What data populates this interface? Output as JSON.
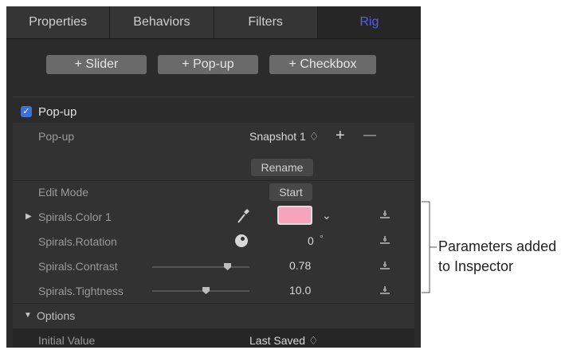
{
  "tabs": [
    "Properties",
    "Behaviors",
    "Filters",
    "Rig"
  ],
  "add_buttons": {
    "slider": "+ Slider",
    "popup": "+ Pop-up",
    "checkbox": "+ Checkbox"
  },
  "group": {
    "title": "Pop-up",
    "checked": true
  },
  "popup_row": {
    "label": "Pop-up",
    "value": "Snapshot 1 ♢",
    "add": "+",
    "remove": "—"
  },
  "rename_label": "Rename",
  "edit_mode": {
    "label": "Edit Mode",
    "button": "Start"
  },
  "params": {
    "color": {
      "label": "Spirals.Color 1",
      "swatch": "#f6a3bd",
      "menu": "⌄"
    },
    "rotation": {
      "label": "Spirals.Rotation",
      "value": "0",
      "unit": "°"
    },
    "contrast": {
      "label": "Spirals.Contrast",
      "value": "0.78",
      "slider_fraction": 0.78
    },
    "tightness": {
      "label": "Spirals.Tightness",
      "value": "10.0"
    }
  },
  "options": {
    "label": "Options",
    "initial_value_label": "Initial Value",
    "initial_value": "Last Saved ♢"
  },
  "annotation": {
    "line1": "Parameters added",
    "line2": "to Inspector"
  },
  "colors": {
    "active_tab": "#5a5cf0",
    "checkbox": "#3f6fd8"
  }
}
